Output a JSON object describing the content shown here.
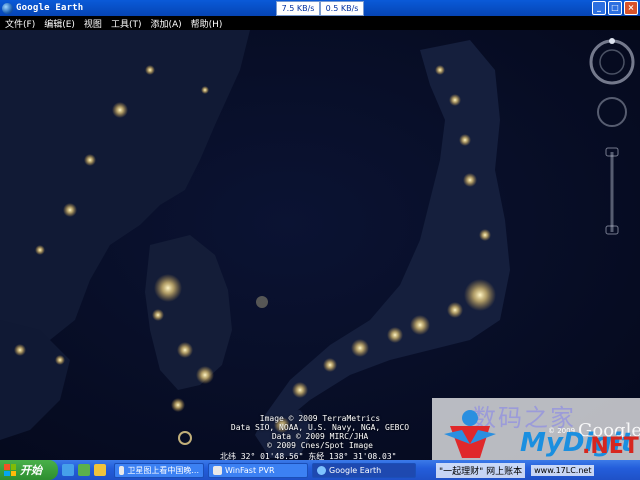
{
  "window": {
    "title": "Google Earth",
    "download_speed": "7.5 KB/s",
    "upload_speed": "0.5 KB/s",
    "minimize": "_",
    "maximize": "□",
    "close": "×"
  },
  "menu": [
    {
      "label": "文件(F)"
    },
    {
      "label": "编辑(E)"
    },
    {
      "label": "视图"
    },
    {
      "label": "工具(T)"
    },
    {
      "label": "添加(A)"
    },
    {
      "label": "帮助(H)"
    }
  ],
  "attribution": {
    "line1": "Image © 2009 TerraMetrics",
    "line2": "Data SIO, NOAA, U.S. Navy, NGA, GEBCO",
    "line3": "Data © 2009 MIRC/JHA",
    "line4": "© 2009 Cnes/Spot Image",
    "coords": "北纬 32° 01'48.56\"  东经 138° 31'08.03\""
  },
  "watermark": {
    "cn": "数码之家",
    "logo": "MyDigit",
    "net": ".NET",
    "google": "Google",
    "year": "© 2009"
  },
  "taskbar": {
    "start": "开始",
    "tasks": [
      {
        "label": "卫星图上看中国晚..."
      },
      {
        "label": "WinFast PVR"
      },
      {
        "label": "Google Earth"
      }
    ],
    "tray_text": "\"一起理财\" 网上账本",
    "tray_site": "www.17LC.net"
  },
  "colors": {
    "titlebar": "#0a5ad8",
    "taskbar": "#245edb",
    "start_button": "#3c9a3d"
  }
}
